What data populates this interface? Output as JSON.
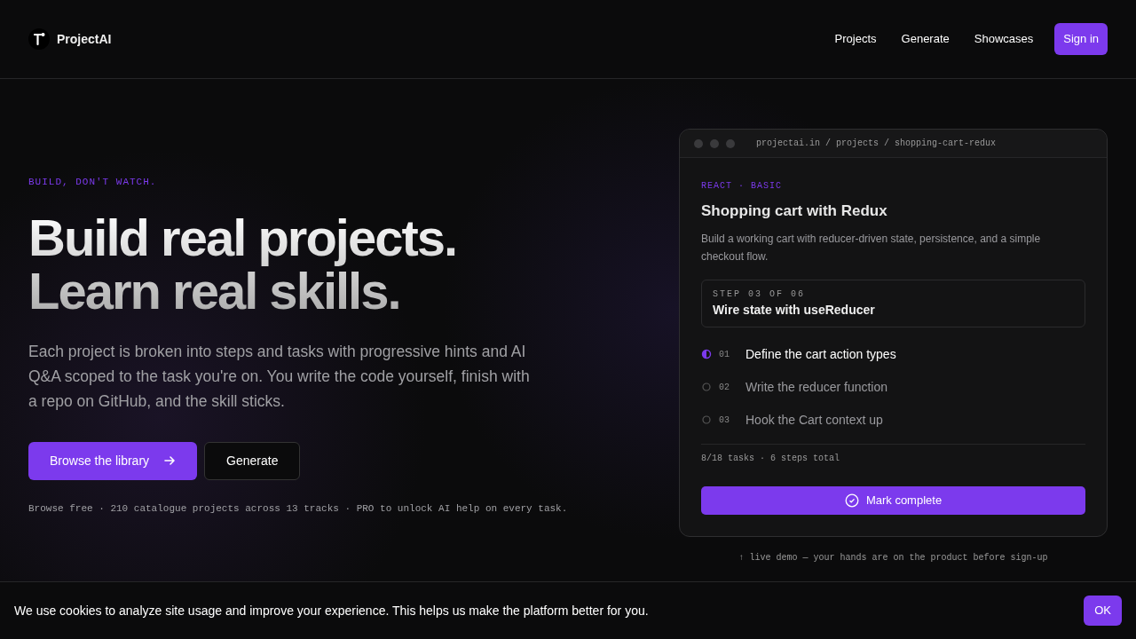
{
  "brand": {
    "name": "ProjectAI"
  },
  "nav": {
    "links": [
      "Projects",
      "Generate",
      "Showcases"
    ],
    "signin": "Sign in"
  },
  "hero": {
    "eyebrow": "BUILD, DON'T WATCH.",
    "title_lines": [
      "Build real projects.",
      "Learn real skills."
    ],
    "body": "Each project is broken into steps and tasks with progressive hints and AI Q&A scoped to the task you're on. You write the code yourself, finish with a repo on GitHub, and the skill sticks.",
    "primary_button": "Browse the library",
    "secondary_button": "Generate",
    "footnote": "Browse free · 210 catalogue projects across 13 tracks · PRO to unlock AI help on every task."
  },
  "demo": {
    "url": "projectai.in / projects / shopping-cart-redux",
    "tag": "REACT · BASIC",
    "title": "Shopping cart with Redux",
    "description": "Build a working cart with reducer-driven state, persistence, and a simple checkout flow.",
    "step_label": "STEP 03 OF 06",
    "step_title": "Wire state with useReducer",
    "tasks": [
      {
        "number": "01",
        "label": "Define the cart action types",
        "active": true
      },
      {
        "number": "02",
        "label": "Write the reducer function",
        "active": false
      },
      {
        "number": "03",
        "label": "Hook the Cart context up",
        "active": false
      }
    ],
    "stats": "8/18 tasks · 6 steps total",
    "button": "Mark complete",
    "caption": "↑ live demo — your hands are on the product before sign-up"
  },
  "cookie": {
    "text": "We use cookies to analyze site usage and improve your experience. This helps us make the platform better for you.",
    "button": "OK"
  }
}
